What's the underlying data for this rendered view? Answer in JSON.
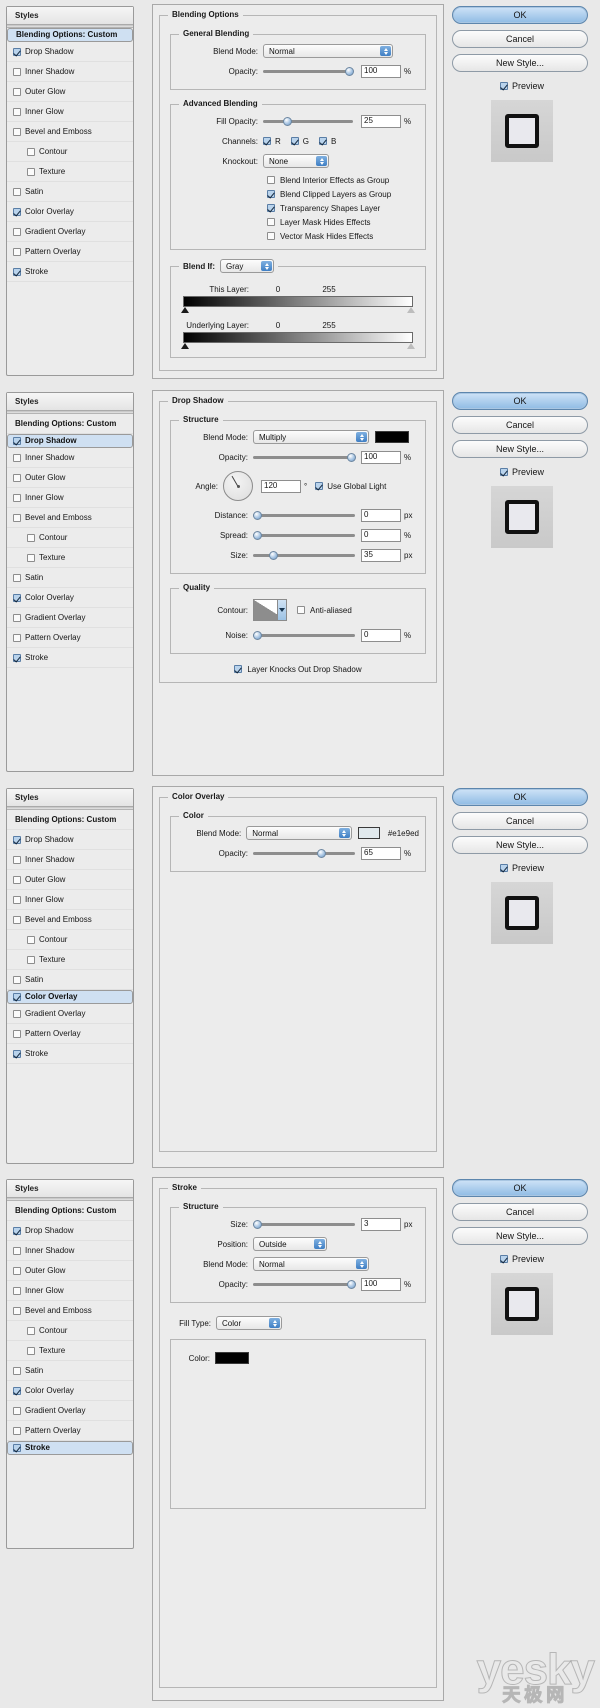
{
  "sidebar": {
    "header_label": "Styles",
    "blending_options_label": "Blending Options: Custom",
    "items": [
      {
        "label": "Drop Shadow",
        "checked": true,
        "sub": false
      },
      {
        "label": "Inner Shadow",
        "checked": false,
        "sub": false
      },
      {
        "label": "Outer Glow",
        "checked": false,
        "sub": false
      },
      {
        "label": "Inner Glow",
        "checked": false,
        "sub": false
      },
      {
        "label": "Bevel and Emboss",
        "checked": false,
        "sub": false
      },
      {
        "label": "Contour",
        "checked": false,
        "sub": true
      },
      {
        "label": "Texture",
        "checked": false,
        "sub": true
      },
      {
        "label": "Satin",
        "checked": false,
        "sub": false
      },
      {
        "label": "Color Overlay",
        "checked": true,
        "sub": false
      },
      {
        "label": "Gradient Overlay",
        "checked": false,
        "sub": false
      },
      {
        "label": "Pattern Overlay",
        "checked": false,
        "sub": false
      },
      {
        "label": "Stroke",
        "checked": true,
        "sub": false
      }
    ]
  },
  "buttons": {
    "ok": "OK",
    "cancel": "Cancel",
    "new_style": "New Style...",
    "preview": "Preview",
    "preview_checked": true
  },
  "panels": [
    {
      "id": "blending-options",
      "selected_sidebar": "Blending Options: Custom",
      "title": "Blending Options",
      "groups": {
        "general": {
          "title": "General Blending",
          "blend_mode_label": "Blend Mode:",
          "blend_mode_value": "Normal",
          "opacity_label": "Opacity:",
          "opacity_value": "100",
          "opacity_unit": "%",
          "opacity_pct": 100
        },
        "advanced": {
          "title": "Advanced Blending",
          "fill_opacity_label": "Fill Opacity:",
          "fill_opacity_value": "25",
          "fill_opacity_unit": "%",
          "fill_opacity_pct": 25,
          "channels_label": "Channels:",
          "channels": [
            {
              "label": "R",
              "checked": true
            },
            {
              "label": "G",
              "checked": true
            },
            {
              "label": "B",
              "checked": true
            }
          ],
          "knockout_label": "Knockout:",
          "knockout_value": "None",
          "checkboxes": [
            {
              "label": "Blend Interior Effects as Group",
              "checked": false
            },
            {
              "label": "Blend Clipped Layers as Group",
              "checked": true
            },
            {
              "label": "Transparency Shapes Layer",
              "checked": true
            },
            {
              "label": "Layer Mask Hides Effects",
              "checked": false
            },
            {
              "label": "Vector Mask Hides Effects",
              "checked": false
            }
          ]
        },
        "blend_if": {
          "label": "Blend If:",
          "channel_value": "Gray",
          "this_layer_label": "This Layer:",
          "this_layer_min": "0",
          "this_layer_max": "255",
          "underlying_label": "Underlying Layer:",
          "underlying_min": "0",
          "underlying_max": "255"
        }
      }
    },
    {
      "id": "drop-shadow",
      "selected_sidebar": "Drop Shadow",
      "title": "Drop Shadow",
      "groups": {
        "structure": {
          "title": "Structure",
          "blend_mode_label": "Blend Mode:",
          "blend_mode_value": "Multiply",
          "shadow_color": "#000000",
          "opacity_label": "Opacity:",
          "opacity_value": "100",
          "opacity_unit": "%",
          "opacity_pct": 100,
          "angle_label": "Angle:",
          "angle_value": "120",
          "angle_unit": "°",
          "use_global_light_label": "Use Global Light",
          "use_global_light_checked": true,
          "distance_label": "Distance:",
          "distance_value": "0",
          "distance_unit": "px",
          "distance_pct": 0,
          "spread_label": "Spread:",
          "spread_value": "0",
          "spread_unit": "%",
          "spread_pct": 0,
          "size_label": "Size:",
          "size_value": "35",
          "size_unit": "px",
          "size_pct": 14
        },
        "quality": {
          "title": "Quality",
          "contour_label": "Contour:",
          "anti_aliased_label": "Anti-aliased",
          "anti_aliased_checked": false,
          "noise_label": "Noise:",
          "noise_value": "0",
          "noise_unit": "%",
          "noise_pct": 0,
          "knocks_out_label": "Layer Knocks Out Drop Shadow",
          "knocks_out_checked": true
        }
      }
    },
    {
      "id": "color-overlay",
      "selected_sidebar": "Color Overlay",
      "title": "Color Overlay",
      "groups": {
        "color": {
          "title": "Color",
          "blend_mode_label": "Blend Mode:",
          "blend_mode_value": "Normal",
          "overlay_color": "#e1e9ed",
          "overlay_color_text": "#e1e9ed",
          "opacity_label": "Opacity:",
          "opacity_value": "65",
          "opacity_unit": "%",
          "opacity_pct": 65
        }
      }
    },
    {
      "id": "stroke",
      "selected_sidebar": "Stroke",
      "title": "Stroke",
      "groups": {
        "structure": {
          "title": "Structure",
          "size_label": "Size:",
          "size_value": "3",
          "size_unit": "px",
          "size_pct": 2,
          "position_label": "Position:",
          "position_value": "Outside",
          "blend_mode_label": "Blend Mode:",
          "blend_mode_value": "Normal",
          "opacity_label": "Opacity:",
          "opacity_value": "100",
          "opacity_unit": "%",
          "opacity_pct": 100
        },
        "fill": {
          "fill_type_label": "Fill Type:",
          "fill_type_value": "Color",
          "color_label": "Color:",
          "color_value": "#000000"
        }
      }
    }
  ],
  "watermark": {
    "text": "yesky",
    "cn": "天极网"
  }
}
